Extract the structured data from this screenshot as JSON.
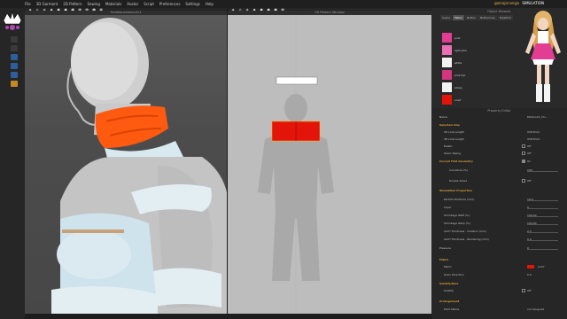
{
  "menubar": {
    "items": [
      "File",
      "3D Garment",
      "2D Pattern",
      "Sewing",
      "Materials",
      "Avatar",
      "Script",
      "Preferences",
      "Settings",
      "Help"
    ],
    "account": "gomajorverga",
    "simulation_label": "SIMULATION"
  },
  "viewport3d": {
    "title": "Traditionaldress-fix1"
  },
  "viewport2d": {
    "title": "2D Pattern Window"
  },
  "object_browser": {
    "title": "Object Browser",
    "tabs": [
      "Scene",
      "Fabric",
      "Button",
      "Buttonhole",
      "Topstitch"
    ],
    "active_tab": "Fabric",
    "fabrics": [
      {
        "label": "pink ",
        "color": "#e23d93"
      },
      {
        "label": "light pink",
        "color": "#ec6fb3"
      },
      {
        "label": "white",
        "color": "#f2f2f2"
      },
      {
        "label": "pink top",
        "color": "#d4357f"
      },
      {
        "label": "shoes",
        "color": "#f3f3f3"
      },
      {
        "label": "scarf",
        "color": "#e3150b"
      }
    ]
  },
  "property_editor": {
    "title": "Property Editor",
    "header_name_label": "Name",
    "header_name_value": "Pattern22_Clo...",
    "rows": [
      {
        "type": "section",
        "label": "Selected Line"
      },
      {
        "type": "value",
        "label": "2D Line Length",
        "value": "938.8mm"
      },
      {
        "type": "value",
        "label": "3D Line Length",
        "value": "938.8mm"
      },
      {
        "type": "check",
        "label": "Elastic",
        "value": "Off"
      },
      {
        "type": "check",
        "label": "Seam Taping",
        "value": "Off"
      },
      {
        "type": "section",
        "label": "Curved Fold Geometry",
        "checkbox": true,
        "value": "On"
      },
      {
        "type": "slider",
        "label": "Curvature (%)",
        "value": "100"
      },
      {
        "type": "check",
        "label": "Double Sided",
        "value": "Off"
      },
      {
        "type": "section",
        "label": "Simulation Properties"
      },
      {
        "type": "slider",
        "label": "Particle Distance (mm)",
        "value": "10.0"
      },
      {
        "type": "slider",
        "label": "Layer",
        "value": "0"
      },
      {
        "type": "slider",
        "label": "Shrinkage Weft (%)",
        "value": "100.00"
      },
      {
        "type": "slider",
        "label": "Shrinkage Warp (%)",
        "value": "100.00"
      },
      {
        "type": "slider",
        "label": "Add'l Thickness - Collision (mm)",
        "value": "2.5"
      },
      {
        "type": "slider",
        "label": "Add'l Thickness - Rendering (mm)",
        "value": "0.0"
      },
      {
        "type": "slider",
        "label": "Pressure",
        "value": "0"
      },
      {
        "type": "section",
        "label": "Fabric"
      },
      {
        "type": "swatch",
        "label": "Fabric",
        "value": "scarf"
      },
      {
        "type": "value",
        "label": "Grain Direction",
        "value": "0.0"
      },
      {
        "type": "section",
        "label": "Solidify/Glue"
      },
      {
        "type": "check",
        "label": "Solidify",
        "value": "Off"
      },
      {
        "type": "section",
        "label": "Arrangement"
      },
      {
        "type": "value",
        "label": "Point Name",
        "value": "not assigned"
      }
    ]
  },
  "colors": {
    "scarf": "#ff5a10",
    "scarf_2d": "#e3150b",
    "skin": "#c8c8c8",
    "garment": "#cfe3ec"
  }
}
